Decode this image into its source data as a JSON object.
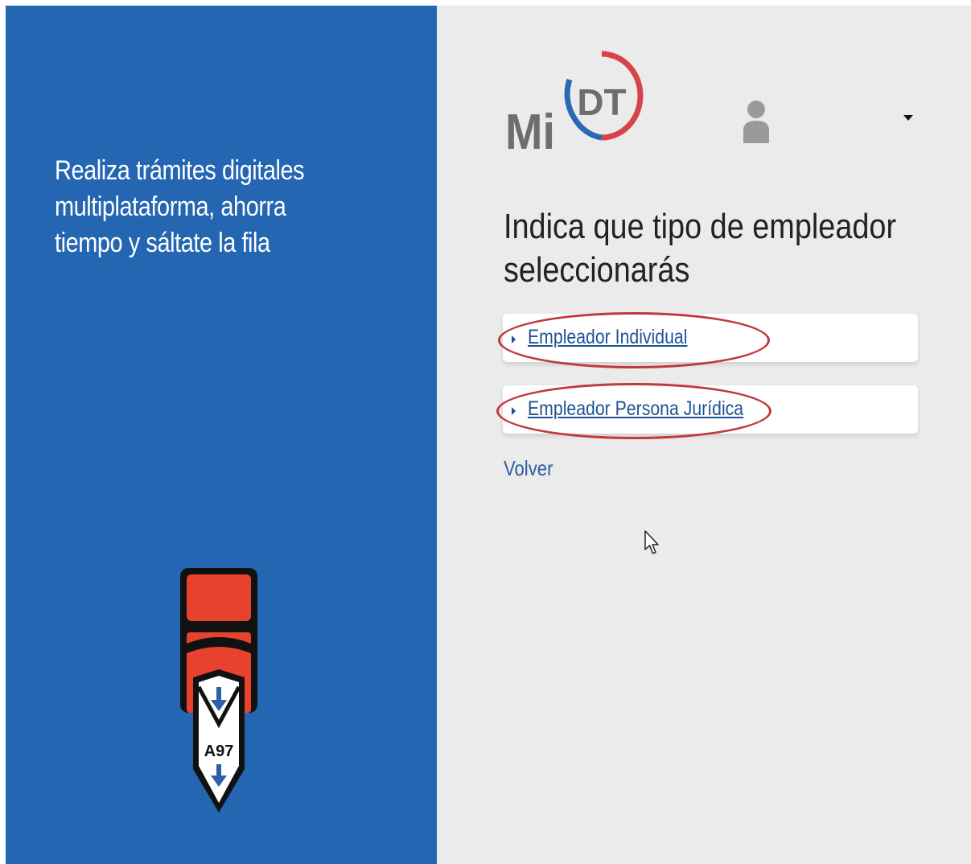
{
  "left_panel": {
    "tagline_lines": [
      "Realiza trámites digitales",
      "multiplataforma, ahorra",
      "tiempo y sáltate la fila"
    ],
    "ticket_number": "A97",
    "background_color": "#2466b2",
    "icons": {
      "illustration": "queue-ticket-icon",
      "arrow": "arrow-down-icon"
    }
  },
  "header": {
    "logo_mi": "Mi",
    "logo_dt": "DT",
    "icons": {
      "user": "user-icon",
      "menu": "caret-down-icon"
    },
    "logo_colors": {
      "red": "#d8434a",
      "blue": "#2a69b4",
      "gray": "#6e6e6e"
    }
  },
  "main": {
    "title_lines": [
      "Indica que tipo de empleador",
      "seleccionarás"
    ],
    "options": [
      {
        "label": "Empleador Individual"
      },
      {
        "label": "Empleador Persona Jurídica"
      }
    ],
    "back_label": "Volver",
    "link_color": "#1f5494",
    "highlight_color": "#c0393b",
    "background_color": "#ebebeb"
  },
  "cursor": {
    "icon": "mouse-pointer-icon"
  }
}
